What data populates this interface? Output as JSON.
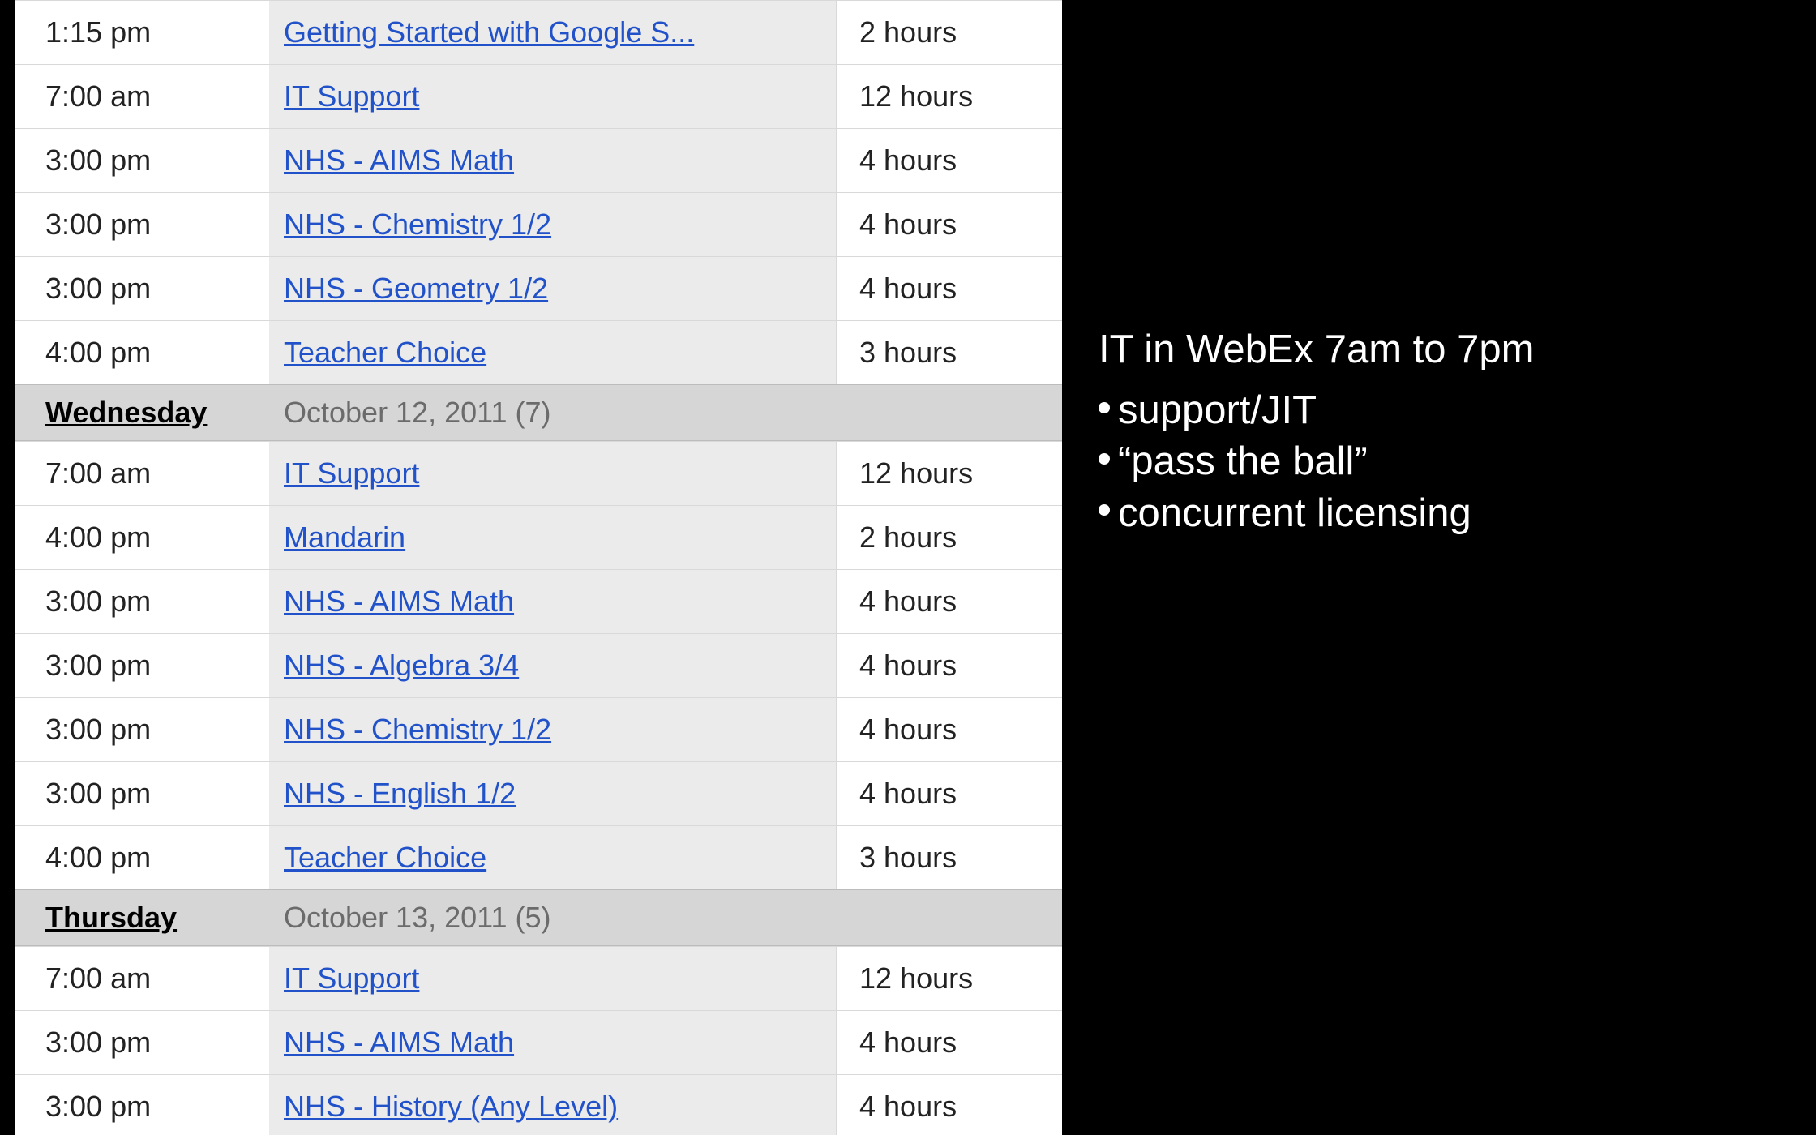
{
  "calendar": {
    "sections": [
      {
        "events": [
          {
            "time": "1:15 pm",
            "title": "Getting Started with Google S...",
            "duration": "2 hours"
          },
          {
            "time": "7:00 am",
            "title": "IT Support",
            "duration": "12 hours"
          },
          {
            "time": "3:00 pm",
            "title": "NHS - AIMS Math",
            "duration": "4 hours"
          },
          {
            "time": "3:00 pm",
            "title": "NHS - Chemistry 1/2",
            "duration": "4 hours"
          },
          {
            "time": "3:00 pm",
            "title": "NHS - Geometry 1/2",
            "duration": "4 hours"
          },
          {
            "time": "4:00 pm",
            "title": "Teacher Choice",
            "duration": "3 hours"
          }
        ]
      },
      {
        "day_name": "Wednesday",
        "day_date": "October 12, 2011 (7)",
        "events": [
          {
            "time": "7:00 am",
            "title": "IT Support",
            "duration": "12 hours"
          },
          {
            "time": "4:00 pm",
            "title": "Mandarin",
            "duration": "2 hours"
          },
          {
            "time": "3:00 pm",
            "title": "NHS - AIMS Math",
            "duration": "4 hours"
          },
          {
            "time": "3:00 pm",
            "title": "NHS - Algebra 3/4",
            "duration": "4 hours"
          },
          {
            "time": "3:00 pm",
            "title": "NHS - Chemistry 1/2",
            "duration": "4 hours"
          },
          {
            "time": "3:00 pm",
            "title": "NHS - English 1/2",
            "duration": "4 hours"
          },
          {
            "time": "4:00 pm",
            "title": "Teacher Choice",
            "duration": "3 hours"
          }
        ]
      },
      {
        "day_name": "Thursday",
        "day_date": "October 13, 2011 (5)",
        "events": [
          {
            "time": "7:00 am",
            "title": "IT Support",
            "duration": "12 hours"
          },
          {
            "time": "3:00 pm",
            "title": "NHS - AIMS Math",
            "duration": "4 hours"
          },
          {
            "time": "3:00 pm",
            "title": "NHS - History (Any Level)",
            "duration": "4 hours"
          }
        ]
      }
    ]
  },
  "notes": {
    "title": "IT in WebEx 7am to 7pm",
    "bullets": [
      "support/JIT",
      "“pass the ball”",
      "concurrent licensing"
    ]
  }
}
